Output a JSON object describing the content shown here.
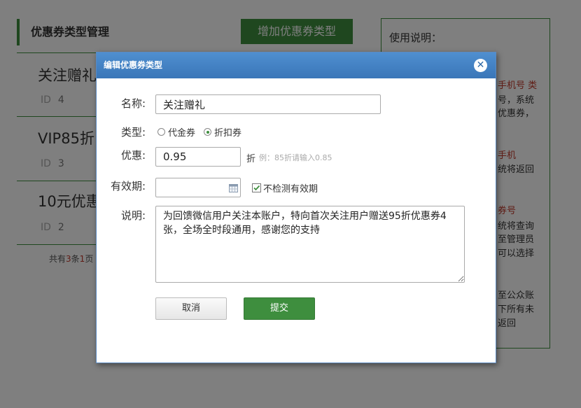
{
  "page": {
    "panel_title": "优惠券类型管理",
    "add_button": "增加优惠券类型",
    "coupons": [
      {
        "name": "关注赠礼",
        "id_label": "ID",
        "id": "4"
      },
      {
        "name": "VIP85折",
        "id_label": "ID",
        "id": "3"
      },
      {
        "name": "10元优惠",
        "id_label": "ID",
        "id": "2"
      }
    ],
    "pager": {
      "prefix": "共有",
      "total": "3",
      "middle": "条",
      "pages": "1",
      "suffix": "页"
    }
  },
  "help": {
    "title": "使用说明：",
    "lines": [
      {
        "text": "手机号 类",
        "color": "red"
      },
      {
        "text": "号，系统",
        "color": "normal"
      },
      {
        "text": "优惠券，",
        "color": "normal"
      },
      {
        "text": "手机",
        "color": "red"
      },
      {
        "text": "统将返回",
        "color": "normal"
      },
      {
        "text": "券号",
        "color": "red"
      },
      {
        "text": "统将查询",
        "color": "normal"
      },
      {
        "text": "至管理员",
        "color": "normal"
      },
      {
        "text": "可以选择",
        "color": "normal"
      },
      {
        "text": "至公众账",
        "color": "normal"
      },
      {
        "text": "下所有未",
        "color": "normal"
      },
      {
        "text": "返回",
        "color": "normal"
      }
    ]
  },
  "modal": {
    "title": "编辑优惠券类型",
    "close_icon": "close-icon",
    "name_label": "名称:",
    "name_value": "关注赠礼",
    "type_label": "类型:",
    "type_options": [
      "代金券",
      "折扣券"
    ],
    "type_selected": "折扣券",
    "discount_label": "优惠:",
    "discount_value": "0.95",
    "discount_unit": "折",
    "discount_hint": "例：85折请输入0.85",
    "validity_label": "有效期:",
    "validity_value": "",
    "no_check_label": "不检测有效期",
    "no_check_checked": true,
    "desc_label": "说明:",
    "desc_value": "为回馈微信用户关注本账户，特向首次关注用户赠送95折优惠券4张，全场全时段通用，感谢您的支持",
    "cancel_label": "取消",
    "submit_label": "提交"
  },
  "colors": {
    "accent_green": "#3e8e3e",
    "header_blue": "#3a76b8",
    "hint_red": "#c0392b"
  }
}
